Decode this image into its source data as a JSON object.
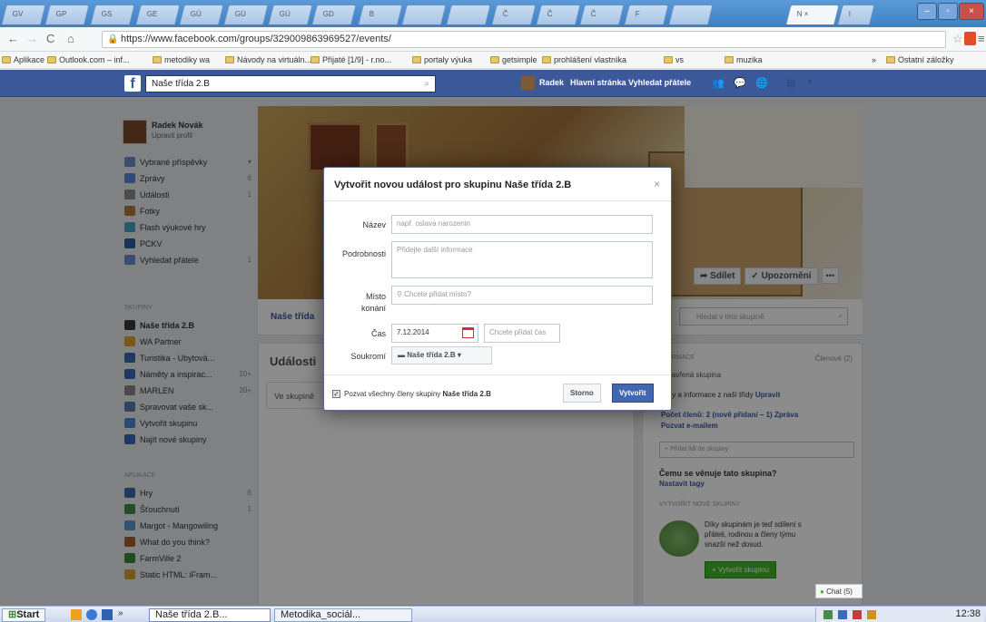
{
  "browser": {
    "tabs": [
      "GV",
      "GP",
      "GS",
      "GE",
      "GÚ",
      "GÚ",
      "GÚ",
      "GD",
      "B",
      "",
      "",
      "Č",
      "Č",
      "Č",
      "F",
      "",
      "N",
      "I"
    ],
    "active_tab": "N ×",
    "url": "https://www.facebook.com/groups/329009863969527/events/",
    "bookmarks": [
      "Aplikace",
      "Outlook.com – inf...",
      "metodiky wa",
      "Návody na virtuáln...",
      "Přijaté [1/9] - r.no...",
      "portaly výuka",
      "getsimple",
      "prohlášení vlastníka",
      "vs",
      "muzika"
    ],
    "bookmarks_more": "»",
    "bookmarks_other": "Ostatní záložky"
  },
  "fb": {
    "search_value": "Naše třída 2.B",
    "user_link": "Radek",
    "home_link": "Hlavní stránka",
    "find_friends": "Vyhledat přátele"
  },
  "left": {
    "profile_name": "Radek Novák",
    "edit_profile": "Upravit profil",
    "items": [
      {
        "label": "Vybrané příspěvky",
        "count": "▾"
      },
      {
        "label": "Zprávy",
        "count": "6"
      },
      {
        "label": "Události",
        "count": "1"
      },
      {
        "label": "Fotky",
        "count": ""
      },
      {
        "label": "Flash výukové hry",
        "count": ""
      },
      {
        "label": "PCKV",
        "count": ""
      },
      {
        "label": "Vyhledat přátele",
        "count": "1"
      }
    ],
    "groups_label": "SKUPINY",
    "groups": [
      {
        "label": "Naše třída 2.B",
        "count": ""
      },
      {
        "label": "WA Partner",
        "count": ""
      },
      {
        "label": "Turistika - Ubytová...",
        "count": ""
      },
      {
        "label": "Náměty a inspirac...",
        "count": "20+"
      },
      {
        "label": "MARLEN",
        "count": "20+"
      },
      {
        "label": "Spravovat vaše sk...",
        "count": ""
      },
      {
        "label": "Vytvořit skupinu",
        "count": ""
      },
      {
        "label": "Najít nové skupiny",
        "count": ""
      }
    ],
    "apps_label": "APLIKACE",
    "apps": [
      {
        "label": "Hry",
        "count": "6"
      },
      {
        "label": "Šťouchnutí",
        "count": "1"
      },
      {
        "label": "Margot - Mangowiling",
        "count": ""
      },
      {
        "label": "What do you think?",
        "count": ""
      },
      {
        "label": "FarmVille 2",
        "count": ""
      },
      {
        "label": "Static HTML: iFram...",
        "count": ""
      }
    ]
  },
  "group": {
    "name_tab": "Naše třída",
    "share": "Sdílet",
    "notify": "Upozornění",
    "more": "•••",
    "events_heading": "Události",
    "events_text": "Ve skupině",
    "search_placeholder": "Hledat v této skupině"
  },
  "right": {
    "info": "FORMACE",
    "members": "Členové (2)",
    "closed": "Uzavřená skupina",
    "desc": "koly a informace z naší třídy",
    "edit": "Upravit",
    "count_line": "Počet členů: 2 (nově přidaní – 1)",
    "msg": "Zpráva",
    "invite_email": "Pozvat e-mailem",
    "add_placeholder": "+ Přidat lidi do skupiny",
    "question": "Čemu se věnuje tato skupina?",
    "tags": "Nastavit tagy",
    "create_label": "VYTVOŘIT NOVÉ SKUPINY",
    "create_text": "Díky skupinám je teď sdílení s přáteli, rodinou a členy týmu snazší než dosud.",
    "create_btn": "+ Vytvořit skupinu"
  },
  "dialog": {
    "title": "Vytvořit novou událost pro skupinu Naše třída 2.B",
    "close": "×",
    "name_label": "Název",
    "name_placeholder": "např. oslava narozenin",
    "details_label": "Podrobnosti",
    "details_placeholder": "Přidejte další informace",
    "place_label_1": "Místo",
    "place_label_2": "konání",
    "place_placeholder": "Chcete přidat místo?",
    "time_label": "Čas",
    "date_value": "7.12.2014",
    "time_placeholder": "Chcete přidat čas",
    "privacy_label": "Soukromí",
    "privacy_value": "Naše třída 2.B",
    "invite_text": "Pozvat všechny členy skupiny",
    "invite_group": "Naše třída 2.B",
    "cancel": "Storno",
    "create": "Vytvořit"
  },
  "chat": "Chat (5)",
  "taskbar": {
    "start": "Start",
    "more": "»",
    "task1": "Naše třída 2.B...",
    "task2": "Metodika_sociál...",
    "time": "12:38"
  },
  "colors": {
    "fb_blue": "#3b5998",
    "button_blue": "#4267b2",
    "green": "#42b72a"
  }
}
